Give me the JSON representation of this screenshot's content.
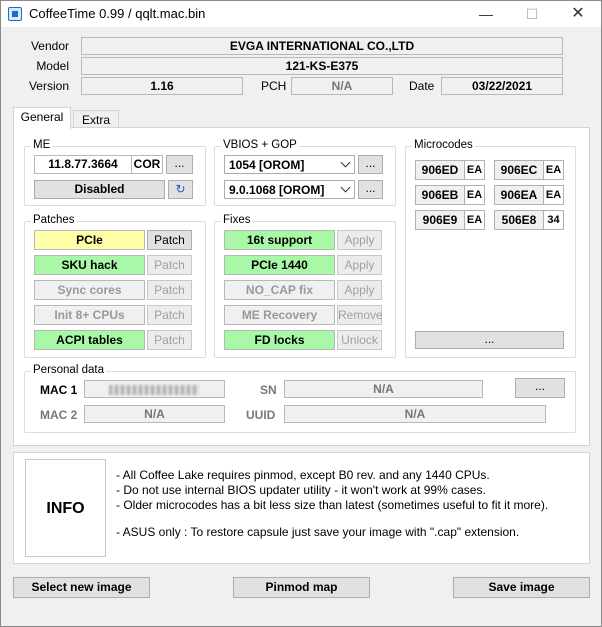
{
  "window": {
    "title": "CoffeeTime 0.99  /  qqlt.mac.bin"
  },
  "header": {
    "vendor_label": "Vendor",
    "vendor_value": "EVGA INTERNATIONAL CO.,LTD",
    "model_label": "Model",
    "model_value": "121-KS-E375",
    "version_label": "Version",
    "version_value": "1.16",
    "pch_label": "PCH",
    "pch_value": "N/A",
    "date_label": "Date",
    "date_value": "03/22/2021"
  },
  "tabs": [
    {
      "label": "General",
      "active": true
    },
    {
      "label": "Extra",
      "active": false
    }
  ],
  "me": {
    "title": "ME",
    "version": "11.8.77.3664",
    "type": "COR",
    "more_label": "...",
    "state": "Disabled"
  },
  "vbios": {
    "title": "VBIOS + GOP",
    "vbios_selected": "1054 [OROM]",
    "gop_selected": "9.0.1068 [OROM]",
    "more_label": "..."
  },
  "microcodes": {
    "title": "Microcodes",
    "items": [
      {
        "code": "906ED",
        "tag": "EA"
      },
      {
        "code": "906EC",
        "tag": "EA"
      },
      {
        "code": "906EB",
        "tag": "EA"
      },
      {
        "code": "906EA",
        "tag": "EA"
      },
      {
        "code": "906E9",
        "tag": "EA"
      },
      {
        "code": "506E8",
        "tag": "34"
      }
    ],
    "more_label": "..."
  },
  "patches": {
    "title": "Patches",
    "items": [
      {
        "label": "PCIe",
        "action": "Patch",
        "state": "yellow",
        "action_enabled": true
      },
      {
        "label": "SKU hack",
        "action": "Patch",
        "state": "green",
        "action_enabled": false
      },
      {
        "label": "Sync cores",
        "action": "Patch",
        "state": "grey",
        "action_enabled": false
      },
      {
        "label": "Init 8+ CPUs",
        "action": "Patch",
        "state": "grey",
        "action_enabled": false
      },
      {
        "label": "ACPI tables",
        "action": "Patch",
        "state": "green",
        "action_enabled": false
      }
    ]
  },
  "fixes": {
    "title": "Fixes",
    "items": [
      {
        "label": "16t support",
        "action": "Apply",
        "state": "green",
        "action_enabled": false
      },
      {
        "label": "PCIe 1440",
        "action": "Apply",
        "state": "green",
        "action_enabled": false
      },
      {
        "label": "NO_CAP fix",
        "action": "Apply",
        "state": "grey",
        "action_enabled": false
      },
      {
        "label": "ME Recovery",
        "action": "Remove",
        "state": "grey",
        "action_enabled": false
      },
      {
        "label": "FD locks",
        "action": "Unlock",
        "state": "green",
        "action_enabled": false
      }
    ]
  },
  "personal": {
    "title": "Personal data",
    "mac1_label": "MAC 1",
    "mac2_label": "MAC 2",
    "mac2_value": "N/A",
    "sn_label": "SN",
    "sn_value": "N/A",
    "uuid_label": "UUID",
    "uuid_value": "N/A",
    "more_label": "..."
  },
  "info": {
    "box_label": "INFO",
    "lines": [
      "- All Coffee Lake requires pinmod, except B0 rev. and any 1440 CPUs.",
      "- Do not use internal BIOS updater utility - it won't work at 99% cases.",
      "- Older microcodes has a bit less size than latest (sometimes useful to fit it more).",
      "- ASUS only : To restore capsule just save your image with \".cap\" extension."
    ]
  },
  "footer": {
    "select_label": "Select new image",
    "pinmod_label": "Pinmod map",
    "save_label": "Save image"
  },
  "colors": {
    "yellow_state": "#ffffa8",
    "green_state": "#a8f8a8",
    "grey_state": "#f0f0f0",
    "window_bg": "#f0f0f0"
  },
  "icons": [
    "app-icon",
    "minimize-icon",
    "maximize-icon",
    "close-icon",
    "reload-icon",
    "chevron-down-icon"
  ]
}
